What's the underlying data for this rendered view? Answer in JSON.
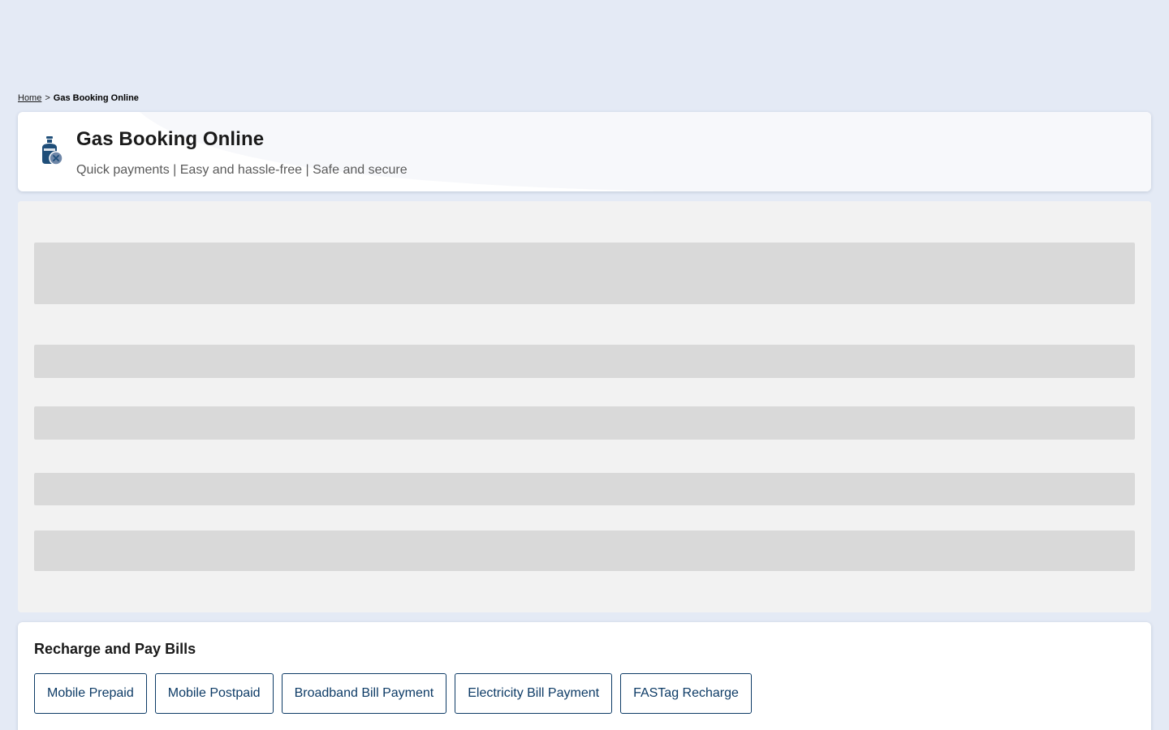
{
  "breadcrumb": {
    "home_label": "Home",
    "separator": ">",
    "current_label": "Gas Booking Online"
  },
  "header": {
    "icon": "gas-cylinder-icon",
    "title": "Gas Booking Online",
    "subtitle": "Quick payments | Easy and hassle-free | Safe and secure"
  },
  "recharge": {
    "title": "Recharge and Pay Bills",
    "links": [
      {
        "label": "Mobile Prepaid"
      },
      {
        "label": "Mobile Postpaid"
      },
      {
        "label": "Broadband Bill Payment"
      },
      {
        "label": "Electricity Bill Payment"
      },
      {
        "label": "FASTag Recharge"
      }
    ]
  },
  "colors": {
    "page_background": "#e4eaf5",
    "card_background": "#ffffff",
    "skeleton_background": "#f2f2f2",
    "skeleton_bar": "#d9d9d9",
    "accent_navy": "#0d3b66",
    "icon_navy": "#1f4e79"
  }
}
